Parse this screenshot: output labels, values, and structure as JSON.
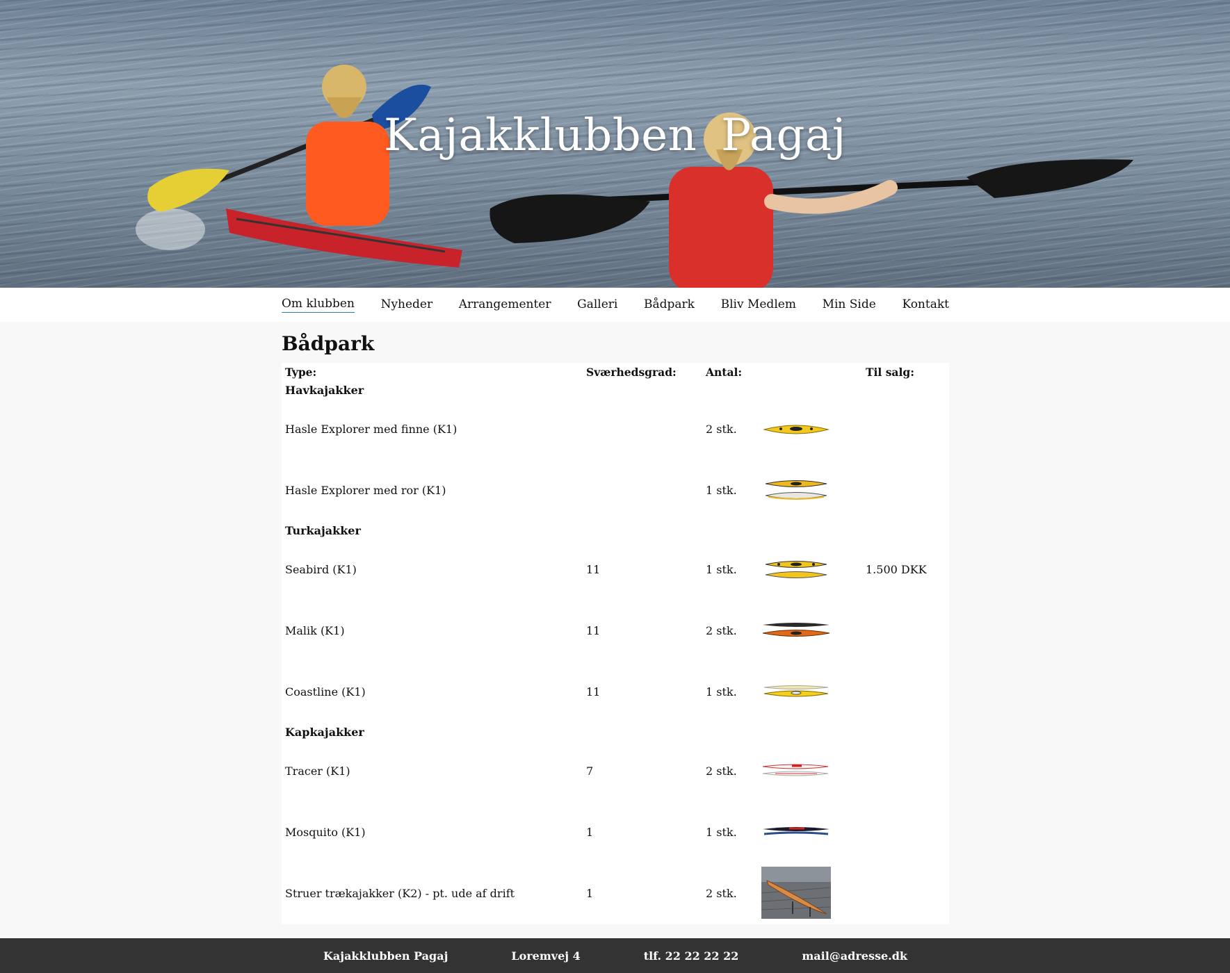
{
  "site": {
    "title": "Kajakklubben  Pagaj"
  },
  "nav": {
    "items": [
      {
        "label": "Om klubben",
        "active": true
      },
      {
        "label": "Nyheder"
      },
      {
        "label": "Arrangementer"
      },
      {
        "label": "Galleri"
      },
      {
        "label": "Bådpark"
      },
      {
        "label": "Bliv Medlem"
      },
      {
        "label": "Min Side"
      },
      {
        "label": "Kontakt"
      }
    ]
  },
  "page": {
    "title": "Bådpark"
  },
  "table": {
    "headers": {
      "type": "Type:",
      "difficulty": "Sværhedsgrad:",
      "count": "Antal:",
      "for_sale": "Til salg:"
    },
    "categories": [
      "Havkajakker",
      "Turkajakker",
      "Kapkajakker"
    ],
    "rows": [
      {
        "name": "Hasle Explorer med finne (K1)",
        "difficulty": "",
        "count": "2 stk.",
        "for_sale": "",
        "icon": "yellow-kayak-image"
      },
      {
        "name": "Hasle Explorer med ror (K1)",
        "difficulty": "",
        "count": "1 stk.",
        "for_sale": "",
        "icon": "yellow-white-kayaks-image"
      },
      {
        "name": "Seabird (K1)",
        "difficulty": "11",
        "count": "1 stk.",
        "for_sale": "1.500 DKK",
        "icon": "yellow-kayaks-image"
      },
      {
        "name": "Malik (K1)",
        "difficulty": "11",
        "count": "2 stk.",
        "for_sale": "",
        "icon": "orange-kayak-image"
      },
      {
        "name": "Coastline (K1)",
        "difficulty": "11",
        "count": "1 stk.",
        "for_sale": "",
        "icon": "yellow-kayak-image"
      },
      {
        "name": "Tracer (K1)",
        "difficulty": "7",
        "count": "2 stk.",
        "for_sale": "",
        "icon": "white-red-kayak-image"
      },
      {
        "name": "Mosquito (K1)",
        "difficulty": "1",
        "count": "1 stk.",
        "for_sale": "",
        "icon": "black-kayak-image"
      },
      {
        "name": "Struer trækajakker (K2) - pt. ude af drift",
        "difficulty": "1",
        "count": "2 stk.",
        "for_sale": "",
        "icon": "wooden-kayak-photo"
      }
    ]
  },
  "footer": {
    "name": "Kajakklubben Pagaj",
    "address": "Loremvej 4",
    "phone": "tlf. 22 22 22 22",
    "email": "mail@adresse.dk"
  },
  "colors": {
    "footer_bg": "#333333",
    "nav_underline": "#2a7fa8"
  }
}
